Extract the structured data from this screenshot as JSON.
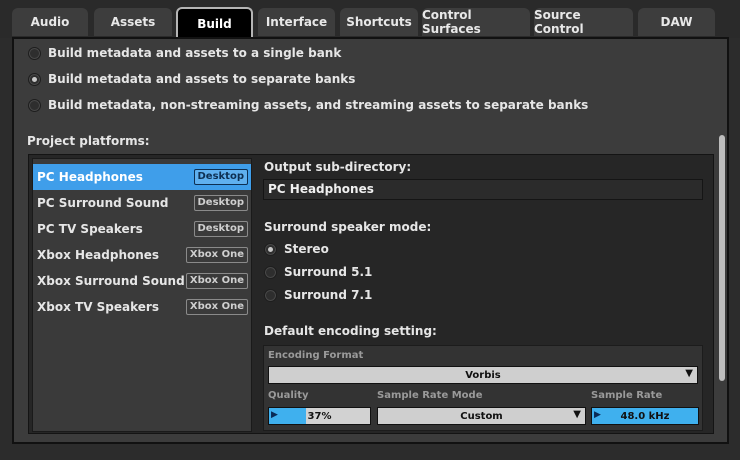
{
  "tabs": [
    {
      "label": "Audio"
    },
    {
      "label": "Assets"
    },
    {
      "label": "Build",
      "active": true
    },
    {
      "label": "Interface"
    },
    {
      "label": "Shortcuts"
    },
    {
      "label": "Control Surfaces"
    },
    {
      "label": "Source Control"
    },
    {
      "label": "DAW"
    }
  ],
  "bank_options": [
    {
      "label": "Build metadata and assets to a single bank",
      "checked": false
    },
    {
      "label": "Build metadata and assets to separate banks",
      "checked": true
    },
    {
      "label": "Build metadata, non-streaming assets, and streaming assets to separate banks",
      "checked": false
    }
  ],
  "project_platforms_label": "Project platforms:",
  "platforms": [
    {
      "name": "PC Headphones",
      "tag": "Desktop",
      "selected": true
    },
    {
      "name": "PC Surround Sound",
      "tag": "Desktop",
      "selected": false
    },
    {
      "name": "PC TV Speakers",
      "tag": "Desktop",
      "selected": false
    },
    {
      "name": "Xbox Headphones",
      "tag": "Xbox One",
      "selected": false
    },
    {
      "name": "Xbox Surround Sound",
      "tag": "Xbox One",
      "selected": false
    },
    {
      "name": "Xbox TV Speakers",
      "tag": "Xbox One",
      "selected": false
    }
  ],
  "detail": {
    "output_label": "Output sub-directory:",
    "output_value": "PC Headphones",
    "surround_label": "Surround speaker mode:",
    "surround_options": [
      {
        "label": "Stereo",
        "checked": true
      },
      {
        "label": "Surround 5.1",
        "checked": false
      },
      {
        "label": "Surround 7.1",
        "checked": false
      }
    ],
    "encoding_label": "Default encoding setting:",
    "encoding": {
      "format_label": "Encoding Format",
      "format_value": "Vorbis",
      "quality_label": "Quality",
      "quality_value": "37%",
      "quality_fraction": 0.37,
      "sample_rate_mode_label": "Sample Rate Mode",
      "sample_rate_mode_value": "Custom",
      "sample_rate_label": "Sample Rate",
      "sample_rate_value": "48.0 kHz"
    }
  },
  "colors": {
    "selection_blue": "#3f9eea",
    "slider_blue": "#3fb0ee",
    "panel_bg": "#3c3c3c"
  },
  "icons": {
    "dropdown_caret": "▼",
    "slider_arrow": "▶"
  }
}
